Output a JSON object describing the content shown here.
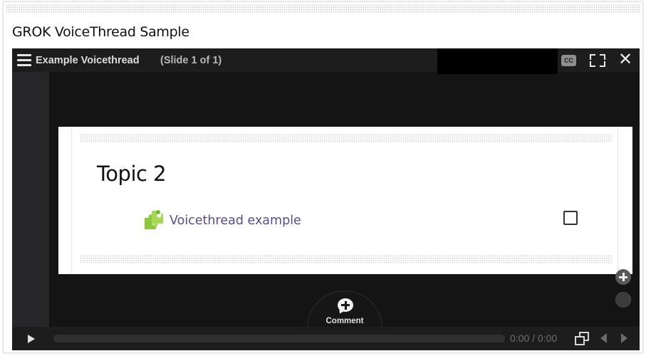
{
  "page": {
    "title": "GROK VoiceThread Sample"
  },
  "player": {
    "title": "Example Voicethread",
    "slide_count": "(Slide 1 of 1)",
    "cc_label": "CC",
    "close_glyph": "✕",
    "time": "0:00 / 0:00",
    "comment_label": "Comment"
  },
  "slide": {
    "heading": "Topic 2",
    "activity_link": "Voicethread example"
  },
  "colors": {
    "player_bg": "#141415",
    "bar_bg": "#1d1d1e",
    "link": "#5a4b8f",
    "puzzle": "#8dc63f"
  },
  "icons": [
    "menu-icon",
    "cc-icon",
    "fullscreen-icon",
    "close-icon",
    "puzzle-icon",
    "checkbox",
    "zoom-in-icon",
    "zoom-out-icon",
    "comment-icon",
    "play-icon",
    "slides-icon",
    "prev-icon",
    "next-icon"
  ]
}
